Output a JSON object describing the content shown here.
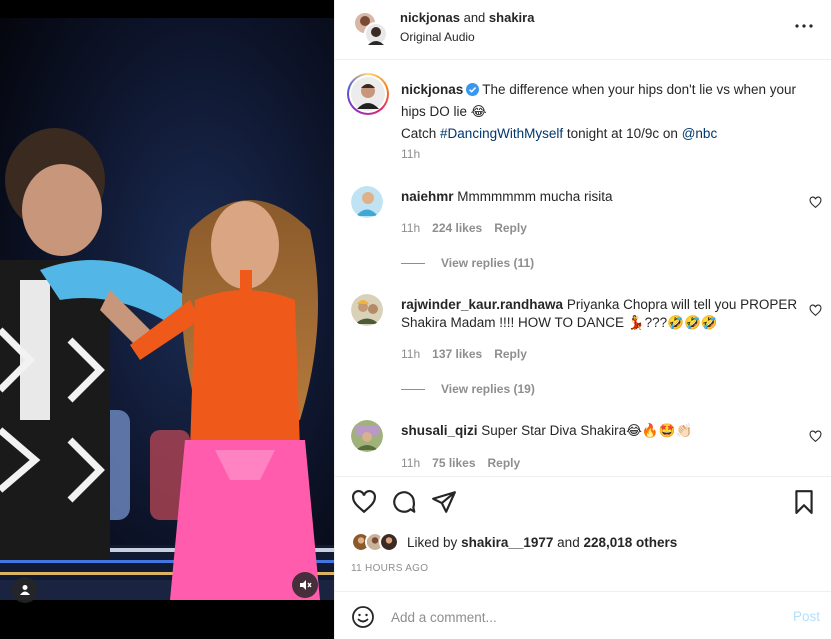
{
  "header": {
    "user1": "nickjonas",
    "joiner": "and",
    "user2": "shakira",
    "audio": "Original Audio"
  },
  "caption": {
    "username": "nickjonas",
    "line1": "The difference when your hips don't lie vs when your hips DO lie 😂",
    "line2_prefix": "Catch",
    "hashtag": "#DancingWithMyself",
    "line2_mid": "tonight at 10/9c on",
    "mention": "@nbc",
    "time": "11h"
  },
  "comments": [
    {
      "username": "naiehmr",
      "text": "Mmmmmmm mucha risita",
      "time": "11h",
      "likes": "224 likes",
      "reply": "Reply",
      "view_replies": "View replies (11)"
    },
    {
      "username": "rajwinder_kaur.randhawa",
      "text": "Priyanka Chopra will tell you PROPER Shakira Madam !!!! HOW TO DANCE 💃???🤣🤣🤣",
      "time": "11h",
      "likes": "137 likes",
      "reply": "Reply",
      "view_replies": "View replies (19)"
    },
    {
      "username": "shusali_qizi",
      "text": "Super Star Diva Shakira😂🔥🤩👏🏻",
      "time": "11h",
      "likes": "75 likes",
      "reply": "Reply"
    }
  ],
  "likes": {
    "prefix": "Liked by",
    "user": "shakira__1977",
    "and": "and",
    "others": "228,018 others"
  },
  "timestamp": "11 HOURS AGO",
  "composer": {
    "placeholder": "Add a comment...",
    "post_label": "Post"
  },
  "colors": {
    "link": "#00376b",
    "verified": "#3897f0",
    "muted": "#8e8e8e",
    "post_disabled": "#b2dffc"
  },
  "icons": [
    "more-options-icon",
    "verified-icon",
    "heart-icon",
    "comment-icon",
    "share-icon",
    "bookmark-icon",
    "emoji-icon",
    "mute-icon",
    "user-tag-icon"
  ]
}
